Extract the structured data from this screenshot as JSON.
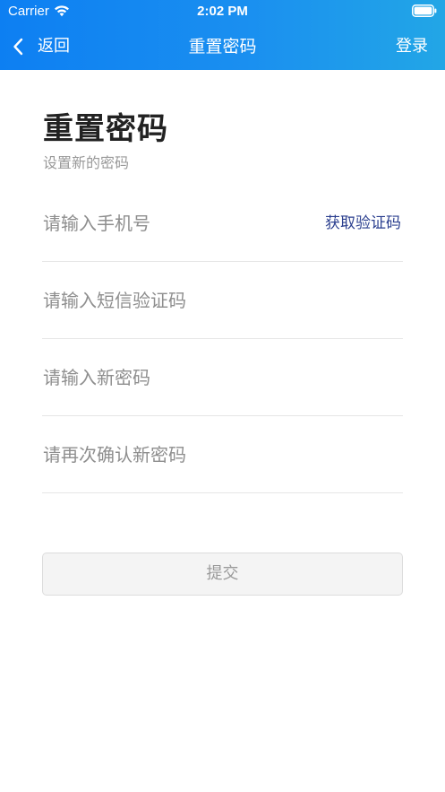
{
  "status_bar": {
    "carrier": "Carrier",
    "time": "2:02 PM",
    "wifi_icon": "wifi-icon",
    "battery_icon": "battery-icon"
  },
  "nav": {
    "back_label": "返回",
    "back_icon": "chevron-left-icon",
    "title": "重置密码",
    "login_label": "登录"
  },
  "page": {
    "title": "重置密码",
    "subtitle": "设置新的密码"
  },
  "form": {
    "phone_placeholder": "请输入手机号",
    "phone_value": "",
    "get_code_label": "获取验证码",
    "sms_code_placeholder": "请输入短信验证码",
    "sms_code_value": "",
    "new_password_placeholder": "请输入新密码",
    "new_password_value": "",
    "confirm_password_placeholder": "请再次确认新密码",
    "confirm_password_value": "",
    "submit_label": "提交"
  },
  "colors": {
    "header_gradient_start": "#0d7ff2",
    "header_gradient_end": "#22a6e6",
    "link": "#2b3f8f",
    "title_text": "#222222",
    "placeholder_text": "#8e8e8e",
    "submit_background": "#f4f4f4"
  }
}
